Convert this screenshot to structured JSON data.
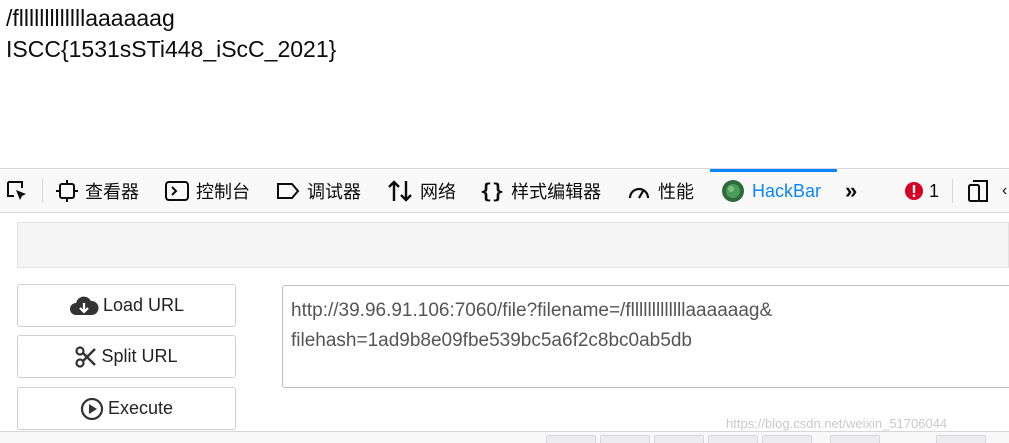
{
  "page": {
    "line1": "/flllllllllllllaaaaaag",
    "line2": "ISCC{1531sSTi448_iScC_2021}"
  },
  "devtools": {
    "tabs": [
      {
        "label": "查看器",
        "icon": "inspector-icon"
      },
      {
        "label": "控制台",
        "icon": "console-icon"
      },
      {
        "label": "调试器",
        "icon": "debugger-icon"
      },
      {
        "label": "网络",
        "icon": "network-icon"
      },
      {
        "label": "样式编辑器",
        "icon": "style-editor-icon"
      },
      {
        "label": "性能",
        "icon": "performance-icon"
      },
      {
        "label": "HackBar",
        "icon": "hackbar-icon",
        "active": true
      }
    ],
    "error_count": "1",
    "colors": {
      "accent": "#0a84ff",
      "error": "#d70022"
    }
  },
  "hackbar": {
    "load_url_label": "Load URL",
    "split_url_label": "Split URL",
    "execute_label": "Execute",
    "url_line1": "http://39.96.91.106:7060/file?filename=/flllllllllllllaaaaaag&",
    "url_line2": "filehash=1ad9b8e09fbe539bc5a6f2c8bc0ab5db"
  },
  "watermark": "https://blog.csdn.net/weixin_51706044"
}
